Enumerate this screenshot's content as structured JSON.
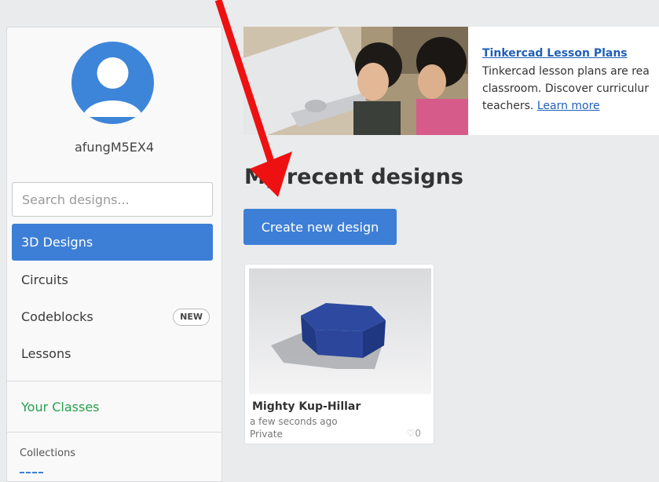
{
  "user": {
    "username": "afungM5EX4"
  },
  "search": {
    "placeholder": "Search designs..."
  },
  "nav": {
    "items": [
      {
        "label": "3D Designs",
        "active": true
      },
      {
        "label": "Circuits"
      },
      {
        "label": "Codeblocks",
        "badge": "NEW"
      },
      {
        "label": "Lessons"
      }
    ],
    "classes_label": "Your Classes",
    "collections_label": "Collections"
  },
  "banner": {
    "title": "Tinkercad Lesson Plans",
    "line1": "Tinkercad lesson plans are rea",
    "line2": "classroom. Discover curriculur",
    "line3_prefix": "teachers.",
    "link": "Learn more"
  },
  "main": {
    "section_title": "My recent designs",
    "create_button": "Create new design"
  },
  "designs": [
    {
      "name": "Mighty Kup-Hillar",
      "time": "a few seconds ago",
      "privacy": "Private",
      "likes": "0"
    }
  ],
  "colors": {
    "accent": "#3d7fd6",
    "classes_green": "#25a04a",
    "annotation_arrow": "#ee1111"
  },
  "icons": [
    "user-avatar-icon",
    "heart-icon"
  ]
}
